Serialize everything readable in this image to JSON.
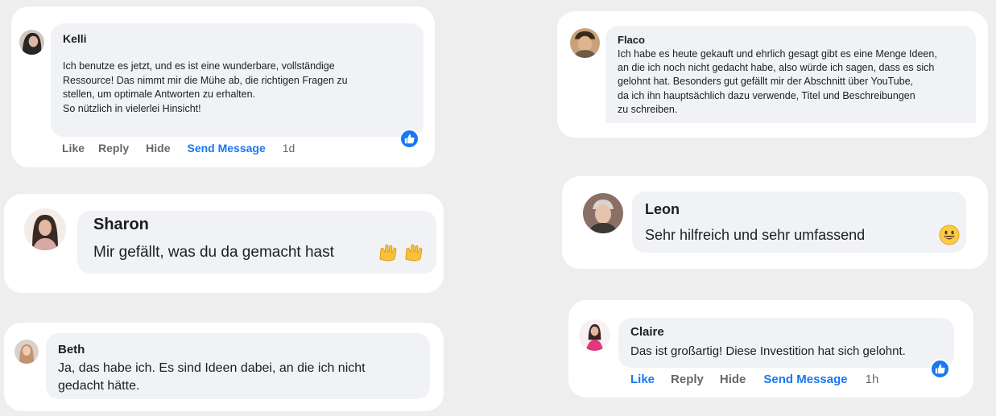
{
  "comments": {
    "kelli": {
      "name": "Kelli",
      "lines": [
        "Ich benutze es jetzt, und es ist eine wunderbare, vollständige",
        "Ressource! Das nimmt mir die Mühe ab, die richtigen Fragen zu",
        "stellen, um optimale Antworten zu erhalten.",
        "So nützlich in vielerlei Hinsicht!"
      ],
      "actions": {
        "like": "Like",
        "reply": "Reply",
        "hide": "Hide",
        "send": "Send Message",
        "time": "1d"
      },
      "reaction_icon": "thumbs-up-icon"
    },
    "sharon": {
      "name": "Sharon",
      "text": "Mir gefällt, was du da gemacht hast",
      "emoji_icon": "raising-hands-icon"
    },
    "beth": {
      "name": "Beth",
      "lines": [
        "Ja, das habe ich. Es sind Ideen dabei, an die ich nicht",
        "gedacht hätte."
      ]
    },
    "flaco": {
      "name": "Flaco",
      "lines": [
        "Ich habe es heute gekauft und ehrlich gesagt gibt es eine Menge Ideen,",
        "an die ich noch nicht gedacht habe, also würde ich sagen, dass es sich",
        "gelohnt hat. Besonders gut gefällt mir der Abschnitt über YouTube,",
        "da ich ihn hauptsächlich dazu verwende, Titel und Beschreibungen",
        "zu schreiben."
      ]
    },
    "leon": {
      "name": "Leon",
      "text": "Sehr hilfreich und sehr umfassend",
      "emoji_icon": "grinning-face-icon"
    },
    "claire": {
      "name": "Claire",
      "text": "Das ist großartig! Diese Investition hat sich gelohnt.",
      "actions": {
        "like": "Like",
        "reply": "Reply",
        "hide": "Hide",
        "send": "Send Message",
        "time": "1h"
      },
      "reaction_icon": "thumbs-up-icon"
    }
  },
  "colors": {
    "background": "#eeeeef",
    "card": "#ffffff",
    "bubble": "#f0f2f5",
    "accent": "#1877f2",
    "muted": "#65676b"
  }
}
